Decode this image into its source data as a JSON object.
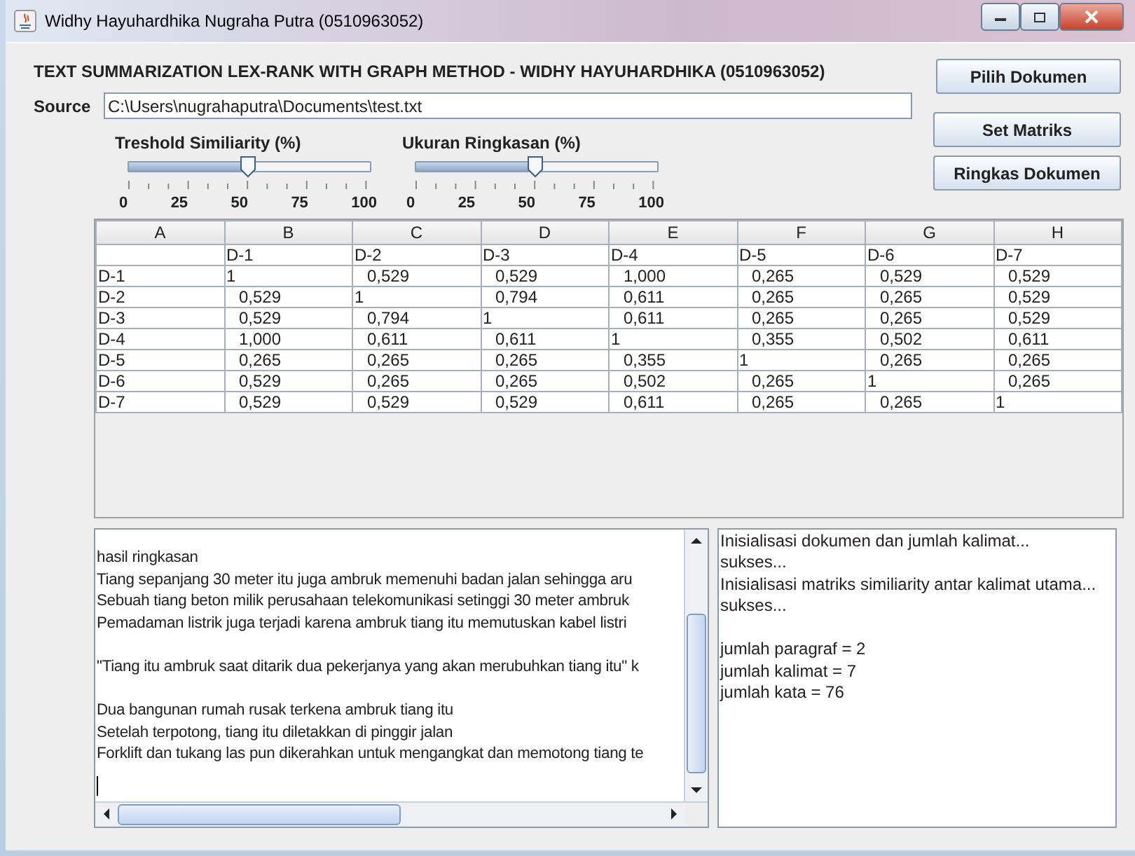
{
  "window": {
    "title": "Widhy Hayuhardhika Nugraha Putra (0510963052)"
  },
  "heading": "TEXT SUMMARIZATION LEX-RANK WITH GRAPH METHOD - WIDHY HAYUHARDHIKA (0510963052)",
  "source": {
    "label": "Source",
    "value": "C:\\Users\\nugrahaputra\\Documents\\test.txt"
  },
  "sliders": [
    {
      "label": "Treshold Similiarity (%)",
      "level": 0.5,
      "ticks": [
        "0",
        "25",
        "50",
        "75",
        "100"
      ]
    },
    {
      "label": "Ukuran Ringkasan (%)",
      "level": 0.5,
      "ticks": [
        "0",
        "25",
        "50",
        "75",
        "100"
      ]
    }
  ],
  "buttons": [
    "Pilih Dokumen",
    "Set Matriks",
    "Ringkas Dokumen"
  ],
  "table": {
    "columns": [
      "A",
      "B",
      "C",
      "D",
      "E",
      "F",
      "G",
      "H"
    ],
    "label_row": [
      "D-1",
      "D-2",
      "D-3",
      "D-4",
      "D-5",
      "D-6",
      "D-7"
    ],
    "rows": [
      {
        "label": "D-1",
        "values": [
          "1",
          "0,529",
          "0,529",
          "1,000",
          "0,265",
          "0,529",
          "0,529"
        ]
      },
      {
        "label": "D-2",
        "values": [
          "0,529",
          "1",
          "0,794",
          "0,611",
          "0,265",
          "0,265",
          "0,529"
        ]
      },
      {
        "label": "D-3",
        "values": [
          "0,529",
          "0,794",
          "1",
          "0,611",
          "0,265",
          "0,265",
          "0,529"
        ]
      },
      {
        "label": "D-4",
        "values": [
          "1,000",
          "0,611",
          "0,611",
          "1",
          "0,355",
          "0,502",
          "0,611"
        ]
      },
      {
        "label": "D-5",
        "values": [
          "0,265",
          "0,265",
          "0,265",
          "0,355",
          "1",
          "0,265",
          "0,265"
        ]
      },
      {
        "label": "D-6",
        "values": [
          "0,529",
          "0,265",
          "0,265",
          "0,502",
          "0,265",
          "1",
          "0,265"
        ]
      },
      {
        "label": "D-7",
        "values": [
          "0,529",
          "0,529",
          "0,529",
          "0,611",
          "0,265",
          "0,265",
          "1"
        ]
      }
    ]
  },
  "summary": {
    "blocks": [
      [
        "hasil ringkasan",
        "Tiang sepanjang 30 meter itu juga ambruk memenuhi badan jalan sehingga aru",
        "Sebuah tiang beton milik perusahaan telekomunikasi setinggi 30 meter ambruk",
        "Pemadaman listrik juga terjadi karena ambruk tiang itu  memutuskan kabel listri"
      ],
      [
        "\"Tiang itu ambruk saat ditarik dua pekerjanya yang akan merubuhkan tiang itu\" k"
      ],
      [
        "Dua bangunan rumah rusak terkena ambruk tiang itu",
        "Setelah terpotong, tiang itu diletakkan di pinggir jalan",
        "Forklift dan tukang las pun dikerahkan untuk mengangkat dan memotong tiang te"
      ]
    ]
  },
  "log": {
    "blocks": [
      [
        "Inisialisasi dokumen dan jumlah kalimat...",
        "sukses...",
        "Inisialisasi matriks similiarity antar kalimat utama...",
        "sukses..."
      ],
      [
        "jumlah paragraf = 2",
        "jumlah kalimat = 7",
        "jumlah kata = 76"
      ]
    ]
  }
}
